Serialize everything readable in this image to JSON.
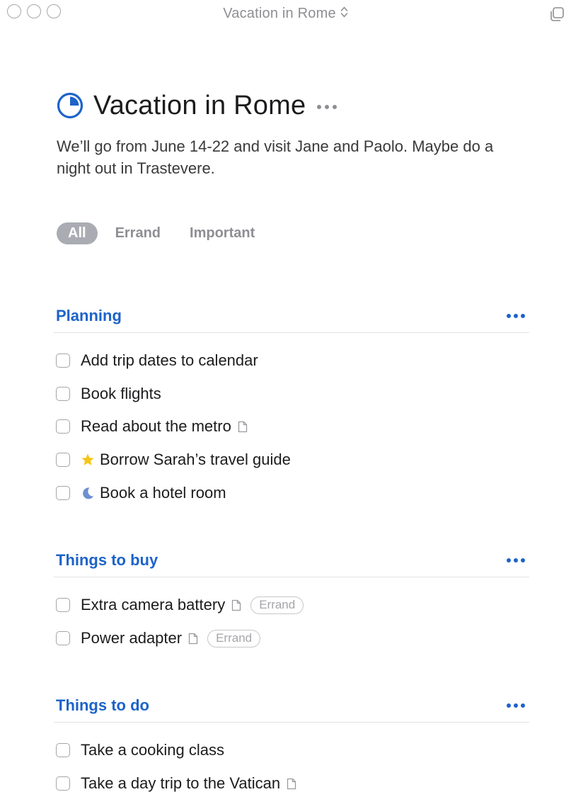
{
  "window": {
    "title": "Vacation in Rome"
  },
  "project": {
    "title": "Vacation in Rome",
    "notes": "We’ll go from June 14-22 and visit Jane and Paolo. Maybe do a night out in Trastevere.",
    "progress": 0.25,
    "accent_color": "#1d63c9"
  },
  "tag_filter": {
    "selected": "All",
    "tags": [
      "All",
      "Errand",
      "Important"
    ]
  },
  "sections": [
    {
      "title": "Planning",
      "tasks": [
        {
          "title": "Add trip dates to calendar",
          "checked": false
        },
        {
          "title": "Book flights",
          "checked": false
        },
        {
          "title": "Read about the metro",
          "checked": false,
          "has_notes": true
        },
        {
          "title": "Borrow Sarah’s travel guide",
          "checked": false,
          "icon": "star-icon",
          "icon_color": "#f5c518"
        },
        {
          "title": "Book a hotel room",
          "checked": false,
          "icon": "moon-icon",
          "icon_color": "#6f8fd1"
        }
      ]
    },
    {
      "title": "Things to buy",
      "tasks": [
        {
          "title": "Extra camera battery",
          "checked": false,
          "has_notes": true,
          "tag": "Errand"
        },
        {
          "title": "Power adapter",
          "checked": false,
          "has_notes": true,
          "tag": "Errand"
        }
      ]
    },
    {
      "title": "Things to do",
      "tasks": [
        {
          "title": "Take a cooking class",
          "checked": false
        },
        {
          "title": "Take a day trip to the Vatican",
          "checked": false,
          "has_notes": true
        }
      ]
    }
  ]
}
